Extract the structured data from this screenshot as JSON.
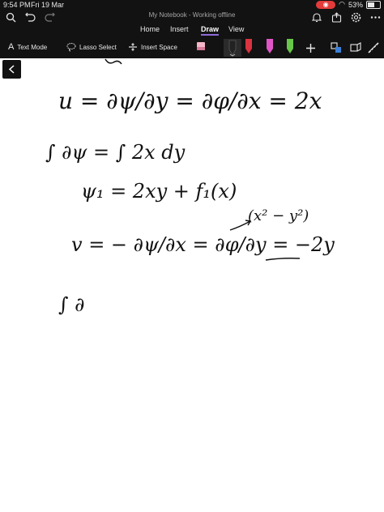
{
  "status": {
    "time": "9:54 PM",
    "date": "Fri 19 Mar",
    "battery": "53%"
  },
  "window": {
    "title": "My Notebook - Working offline"
  },
  "ribbon": {
    "tabs": [
      {
        "label": "Home"
      },
      {
        "label": "Insert"
      },
      {
        "label": "Draw"
      },
      {
        "label": "View"
      }
    ],
    "tools": {
      "text_mode": "Text Mode",
      "lasso_select": "Lasso Select",
      "insert_space": "Insert Space"
    },
    "colors": {
      "pen_red": "#d8333f",
      "pen_pink": "#e056c8",
      "pen_green": "#68c64a",
      "pen_black": "#222222",
      "highlighter": "#f4b6c9",
      "accent": "#8e6bd8"
    }
  },
  "notes": {
    "line1": "u = ∂ψ/∂y = ∂φ/∂x = 2x",
    "line2": "∫ ∂ψ = ∫ 2x dy",
    "line3": "ψ₁ = 2xy + f₁(x)",
    "line4": "v = − ∂ψ/∂x = ∂φ/∂y = −2y",
    "line4_annotation": "(x² − y²)",
    "line5": "∫ ∂"
  }
}
